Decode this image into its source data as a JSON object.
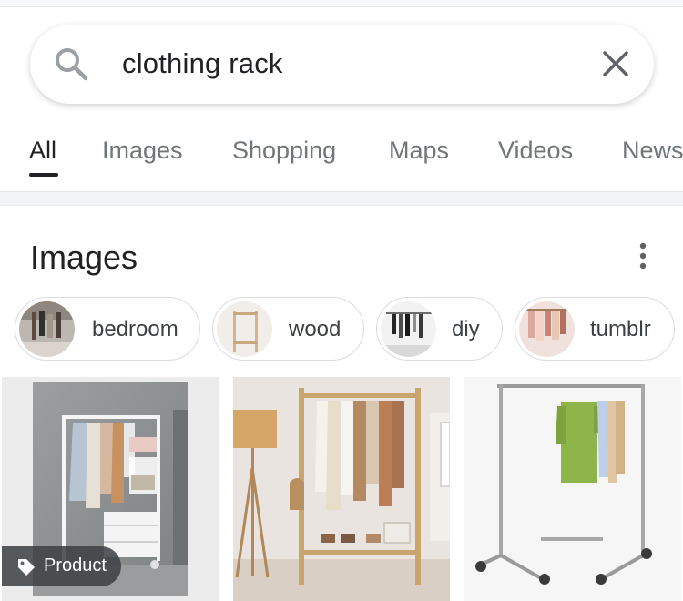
{
  "search": {
    "query": "clothing rack"
  },
  "tabs": [
    {
      "label": "All",
      "active": true
    },
    {
      "label": "Images"
    },
    {
      "label": "Shopping"
    },
    {
      "label": "Maps"
    },
    {
      "label": "Videos"
    },
    {
      "label": "News"
    }
  ],
  "images_section": {
    "title": "Images",
    "chips": [
      {
        "label": "bedroom"
      },
      {
        "label": "wood"
      },
      {
        "label": "diy"
      },
      {
        "label": "tumblr"
      }
    ],
    "results": [
      {
        "badge": "Product"
      }
    ]
  },
  "icons": {
    "search": "search-icon",
    "clear": "close-icon",
    "more": "more-vert-icon",
    "badge": "tag-icon"
  },
  "colors": {
    "text_primary": "#202124",
    "text_secondary": "#70757a",
    "chip_border": "#dadce0"
  }
}
